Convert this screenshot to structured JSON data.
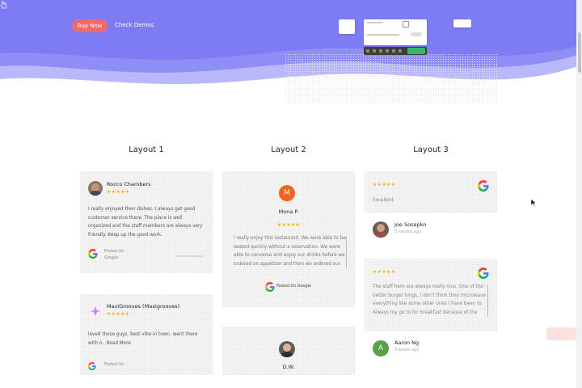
{
  "hero": {
    "buy_label": "Buy Now",
    "demos_label": "Check Demos",
    "colors": {
      "wave_main": "#7d7cf4",
      "wave_light": "#b9b8fb",
      "buy_button": "#ef6a6a"
    }
  },
  "columns": [
    {
      "title": "Layout 1"
    },
    {
      "title": "Layout 2"
    },
    {
      "title": "Layout 3"
    }
  ],
  "layout1": {
    "review1": {
      "name": "Rocco Chambers",
      "stars": "★★★★★",
      "lines": [
        "I really enjoyed their dishes. I always get good",
        "customer service there. The place is well",
        "organized and the staff members are always very",
        "friendly. Keep up the good work."
      ],
      "posted_on": "Posted On",
      "source": "Google"
    },
    "review2": {
      "name": "MaxiGrooves (Maxigrooves)",
      "stars": "★★★★★",
      "lines": [
        "loved those guys. best vibe in town. went there",
        "with o...Read More"
      ],
      "posted_on": "Posted On"
    }
  },
  "layout2": {
    "review1": {
      "initial": "M",
      "name": "Mona P.",
      "stars": "★★★★★",
      "lines": [
        "I really enjoy this restaurant. We were able to be",
        "seated quickly without a reservation. We were",
        "able to converse and enjoy our drinks before we",
        "ordered an appetizer and then we ordered our"
      ],
      "posted": "Posted On Google"
    },
    "review2": {
      "name": "D.W."
    }
  },
  "layout3": {
    "review1": {
      "stars": "★★★★★",
      "caption": "Excellent",
      "name": "Joe Sosepko",
      "time": "3 months ago"
    },
    "review2": {
      "stars": "★★★★★",
      "lines": [
        "The staff here are always really nice. One of the",
        "better burger kings, I don't think they microwave",
        "everything like some other ones I have been to.",
        "Always my go to for breakfast because of the"
      ],
      "initial": "A",
      "name": "Aaron Ng",
      "time": "3 weeks ago"
    }
  },
  "icons": [
    "hand-pointer-icon",
    "google-icon",
    "cursor-arrow-icon",
    "avatar-icon"
  ]
}
